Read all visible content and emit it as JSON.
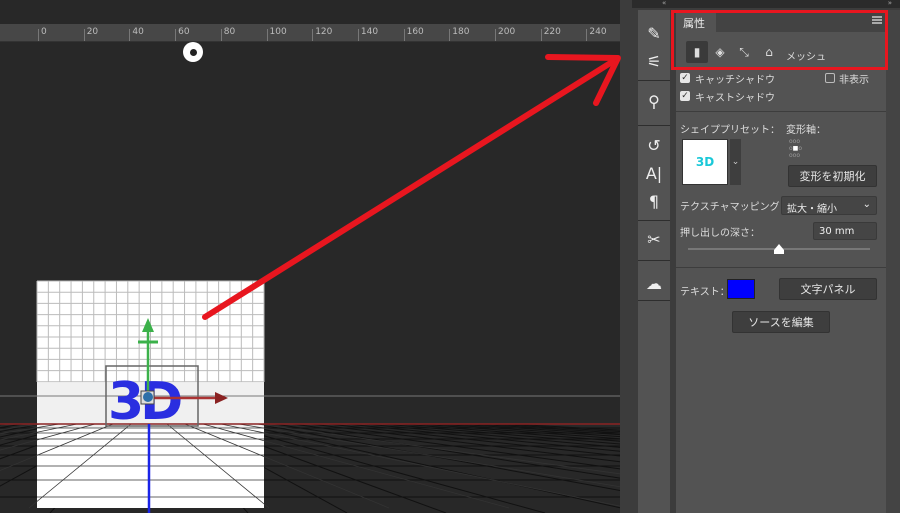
{
  "ruler": {
    "labels": [
      "0",
      "20",
      "40",
      "60",
      "80",
      "100",
      "120",
      "140",
      "160",
      "180",
      "200",
      "220",
      "240"
    ]
  },
  "dock": {
    "collapse_left": "«",
    "collapse_right": "»"
  },
  "tools": [
    {
      "name": "brush-settings-icon",
      "glyph": "✎"
    },
    {
      "name": "adjustments-icon",
      "glyph": "⚟"
    },
    {
      "name": "clone-source-icon",
      "glyph": "⚲"
    },
    {
      "name": "history-icon",
      "glyph": "↺"
    },
    {
      "name": "character-icon",
      "glyph": "A|"
    },
    {
      "name": "paragraph-icon",
      "glyph": "¶"
    },
    {
      "name": "tools-icon",
      "glyph": "✂"
    },
    {
      "name": "creative-cloud-icon",
      "glyph": "☁"
    }
  ],
  "properties": {
    "tab": "属性",
    "mesh_label": "メッシュ",
    "catch_shadow": "キャッチシャドウ",
    "hide": "非表示",
    "cast_shadow": "キャストシャドウ",
    "shape_preset_label": "シェイププリセット：",
    "shape_preview_text": "3D",
    "transform_axis_label": "変形軸：",
    "reset_transform": "変形を初期化",
    "texture_mapping_label": "テクスチャマッピング：",
    "texture_mapping_value": "拡大・縮小",
    "extrusion_depth_label": "押し出しの深さ：",
    "extrusion_depth_value": "30 mm",
    "extrusion_slider_fraction": 0.5,
    "text_label": "テキスト：",
    "text_color": "#0000ff",
    "character_panel": "文字パネル",
    "edit_source": "ソースを編集"
  },
  "colors": {
    "annotation": "#e8161f",
    "accent_text": "#2a2ee0"
  }
}
